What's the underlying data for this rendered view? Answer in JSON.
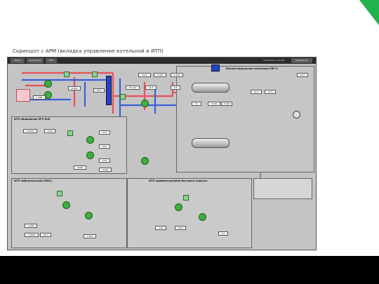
{
  "slide": {
    "title": "Скриншот с АРМ (вкладка управление котельной и ИТП)"
  },
  "scada": {
    "tabs": [
      "Обзор",
      "Котельная",
      "ИТП"
    ],
    "datetime": "12/15/2017 4:53 PM",
    "params_tab": "Параметры",
    "panels": {
      "boiler": "Блочно-модульная котельная УВТ-4",
      "itp_dorm": "ИТП общежитие ЗРУ-6кВ",
      "itp_mns": "ИТП нефтенасосной (МНС)",
      "itp_admin": "ИТП административно-бытового корпуса"
    }
  },
  "values": {
    "v1": "0.398",
    "v2": "8.240",
    "v3": "44.8",
    "v4": "63.2",
    "v5": "0.354",
    "v6": "0.193",
    "v7": "14.3",
    "v8": "5.8",
    "v9": "0.0",
    "v10": "0.344",
    "v11": "0.196",
    "v12": "51.019",
    "v13": "61.0",
    "v14": "12.5",
    "v15": "62.0",
    "v16": "0.0210",
    "v17": "43.8",
    "v18": "37.5",
    "v19": "23.0",
    "v20": "0.864",
    "v21": "49.2",
    "v22": "0.616",
    "v23": "0.488",
    "v24": "0.0494",
    "v25": "28.1",
    "v26": "0.353",
    "v27": "3.52",
    "v28": "26.8",
    "v29": "0.2"
  },
  "colors": {
    "supply": "#e8505b",
    "return": "#3a5fd9",
    "pump": "#3fae3f"
  }
}
